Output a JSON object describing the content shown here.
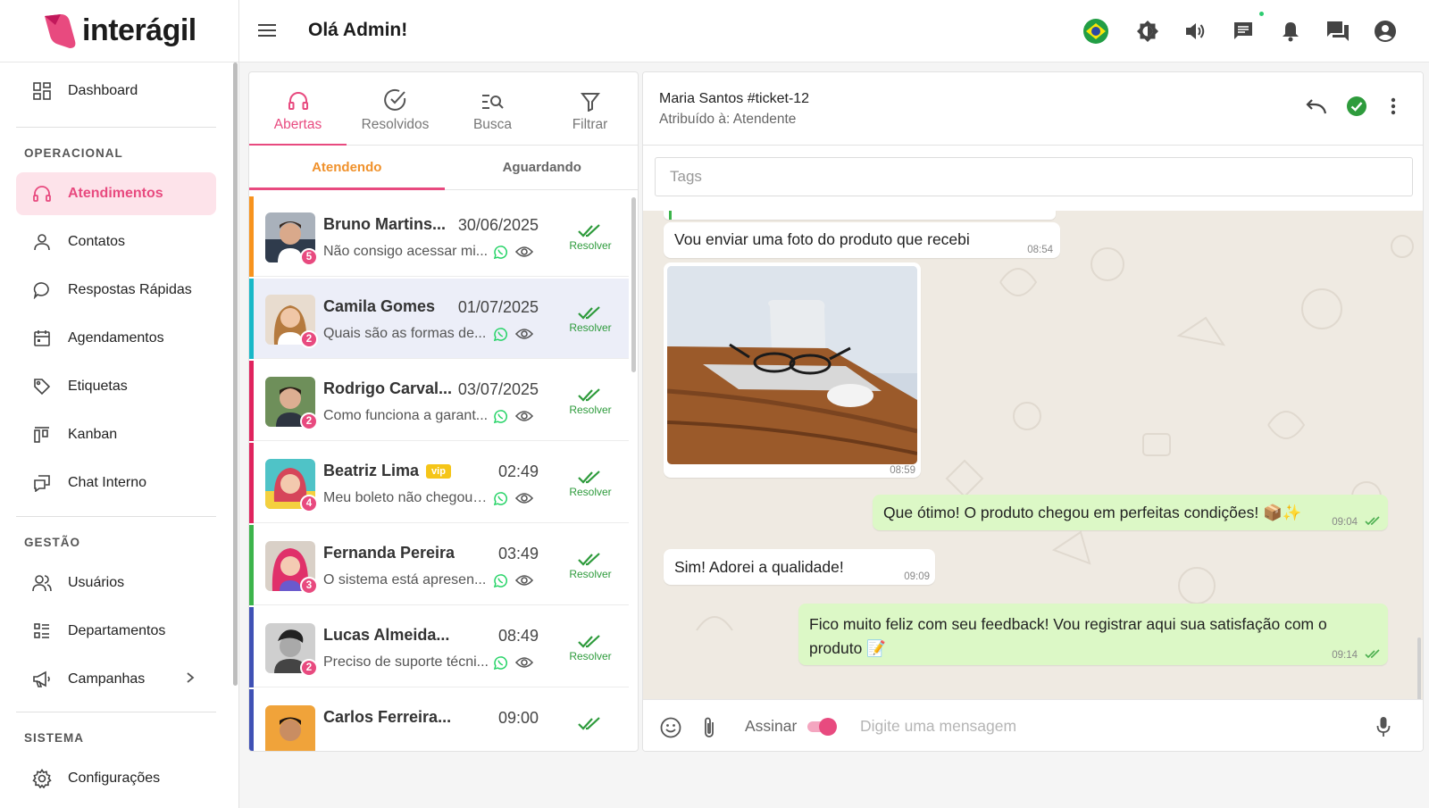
{
  "brand": {
    "name": "interágil",
    "accent": "#e84a7f"
  },
  "topbar": {
    "greeting": "Olá Admin!"
  },
  "sidebar": {
    "items": [
      {
        "label": "Dashboard"
      },
      {
        "label": "Atendimentos"
      },
      {
        "label": "Contatos"
      },
      {
        "label": "Respostas Rápidas"
      },
      {
        "label": "Agendamentos"
      },
      {
        "label": "Etiquetas"
      },
      {
        "label": "Kanban"
      },
      {
        "label": "Chat Interno"
      },
      {
        "label": "Usuários"
      },
      {
        "label": "Departamentos"
      },
      {
        "label": "Campanhas"
      },
      {
        "label": "Configurações"
      }
    ],
    "sections": {
      "operacional": "OPERACIONAL",
      "gestao": "GESTÃO",
      "sistema": "SISTEMA"
    }
  },
  "tickets_panel": {
    "tabs": [
      {
        "label": "Abertas",
        "icon": "headset-icon"
      },
      {
        "label": "Resolvidos",
        "icon": "check-circle-icon"
      },
      {
        "label": "Busca",
        "icon": "search-list-icon"
      },
      {
        "label": "Filtrar",
        "icon": "filter-icon"
      }
    ],
    "subtabs": [
      "Atendendo",
      "Aguardando"
    ],
    "resolve_label": "Resolver",
    "vip_label": "vip",
    "tickets": [
      {
        "name": "Bruno Martins...",
        "date": "30/06/2025",
        "message": "Não consigo acessar mi...",
        "count": "5",
        "bar": "#f7931e"
      },
      {
        "name": "Camila Gomes",
        "date": "01/07/2025",
        "message": "Quais são as formas de...",
        "count": "2",
        "bar": "#19b8c8"
      },
      {
        "name": "Rodrigo Carval...",
        "date": "03/07/2025",
        "message": "Como funciona a garant...",
        "count": "2",
        "bar": "#e0245e"
      },
      {
        "name": "Beatriz Lima",
        "date": "02:49",
        "message": "Meu boleto não chegou ...",
        "count": "4",
        "bar": "#e0245e"
      },
      {
        "name": "Fernanda Pereira",
        "date": "03:49",
        "message": "O sistema está apresen...",
        "count": "3",
        "bar": "#3cb44b"
      },
      {
        "name": "Lucas Almeida...",
        "date": "08:49",
        "message": "Preciso de suporte técni...",
        "count": "2",
        "bar": "#3f51b5"
      },
      {
        "name": "Carlos Ferreira...",
        "date": "09:00",
        "message": "",
        "count": "",
        "bar": "#3f51b5"
      }
    ]
  },
  "chat": {
    "contact": "Maria Santos #ticket-12",
    "assigned": "Atribuído à: Atendente",
    "tags_placeholder": "Tags",
    "messages": [
      {
        "text": "Vou enviar uma foto do produto que recebi",
        "time": "08:54"
      },
      {
        "text": "",
        "time": "08:59"
      },
      {
        "text": "Que ótimo! O produto chegou em perfeitas condições! 📦✨",
        "time": "09:04"
      },
      {
        "text": "Sim! Adorei a qualidade!",
        "time": "09:09"
      },
      {
        "text": "Fico muito feliz com seu feedback! Vou registrar aqui sua satisfação com o produto 📝",
        "time": "09:14"
      }
    ],
    "sign_label": "Assinar",
    "input_placeholder": "Digite uma mensagem"
  }
}
